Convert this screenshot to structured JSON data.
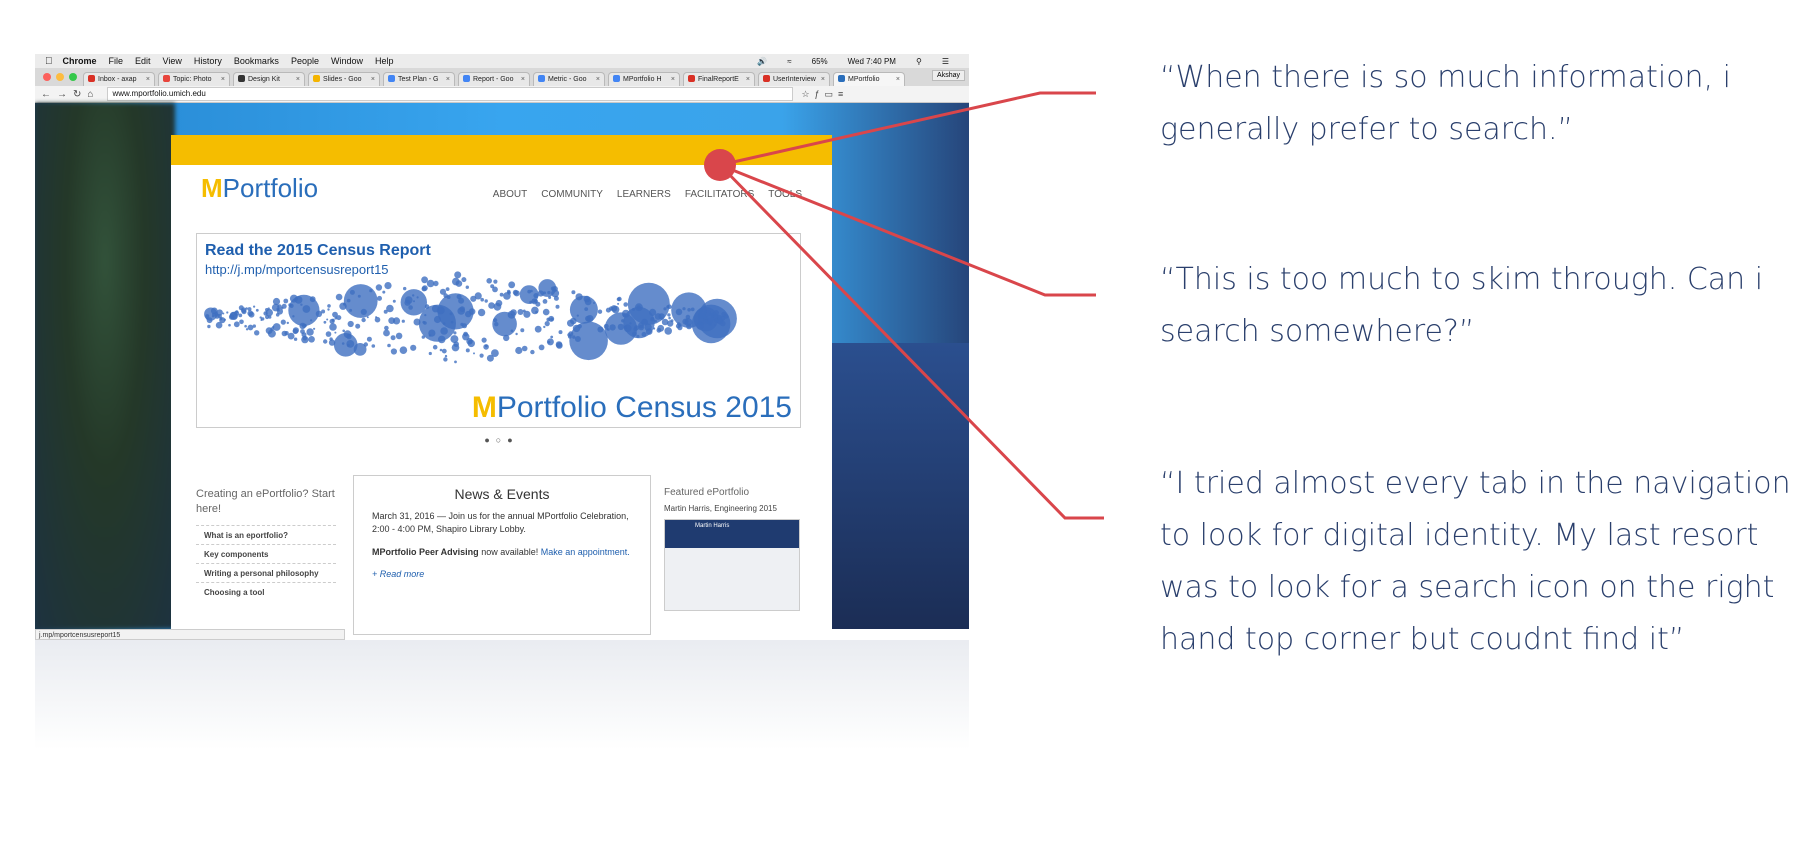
{
  "menubar": {
    "app": "Chrome",
    "items": [
      "File",
      "Edit",
      "View",
      "History",
      "Bookmarks",
      "People",
      "Window",
      "Help"
    ],
    "battery": "65%",
    "clock": "Wed 7:40 PM"
  },
  "tabs": [
    {
      "label": "Inbox - axap",
      "color": "#d93025"
    },
    {
      "label": "Topic: Photo",
      "color": "#e8453c"
    },
    {
      "label": "Design Kit",
      "color": "#333333"
    },
    {
      "label": "Slides - Goo",
      "color": "#f4b400"
    },
    {
      "label": "Test Plan - G",
      "color": "#4285f4"
    },
    {
      "label": "Report - Goo",
      "color": "#4285f4"
    },
    {
      "label": "Metric - Goo",
      "color": "#4285f4"
    },
    {
      "label": "MPortfolio H",
      "color": "#4285f4"
    },
    {
      "label": "FinalReportE",
      "color": "#d93025"
    },
    {
      "label": "UserInterview",
      "color": "#d93025"
    },
    {
      "label": "MPortfolio",
      "color": "#2a6ebb"
    }
  ],
  "browser_user": "Akshay",
  "url": "www.mportfolio.umich.edu",
  "site": {
    "logo_m": "M",
    "logo_text": "Portfolio",
    "menu": [
      "ABOUT",
      "COMMUNITY",
      "LEARNERS",
      "FACILITATORS",
      "TOOLS"
    ],
    "hero_title": "Read the 2015 Census Report",
    "hero_link": "http://j.mp/mportcensusreport15",
    "hero_banner_m": "M",
    "hero_banner_text": "Portfolio Census 2015",
    "creating_heading": "Creating an ePortfolio? Start here!",
    "creating_items": [
      "What is an eportfolio?",
      "Key components",
      "Writing a personal philosophy",
      "Choosing a tool"
    ],
    "news_title": "News & Events",
    "news_item1": "March 31, 2016 — Join us for the annual MPortfolio Celebration, 2:00 - 4:00 PM, Shapiro Library Lobby.",
    "news_item2_bold": "MPortfolio Peer Advising",
    "news_item2_rest": " now available!",
    "news_item2_link": "Make an appointment.",
    "news_more": "+ Read more",
    "featured_heading": "Featured ePortfolio",
    "featured_sub": "Martin Harris, Engineering 2015",
    "featured_card_name": "Martin Harris"
  },
  "status_bar": "j.mp/mportcensusreport15",
  "quotes": {
    "q1": "“When there is so much information, i generally prefer to search.”",
    "q2": "“This is too much to skim through. Can i search somewhere?”",
    "q3": "“I tried almost every tab in the navigation to look for digital identity. My last resort was to look for a search icon on the right hand top corner but coudnt find it”"
  },
  "colors": {
    "accent": "#d9464b",
    "maize": "#f5bd00",
    "blue": "#2a6ebb",
    "quote_text": "#2a3f6c"
  }
}
